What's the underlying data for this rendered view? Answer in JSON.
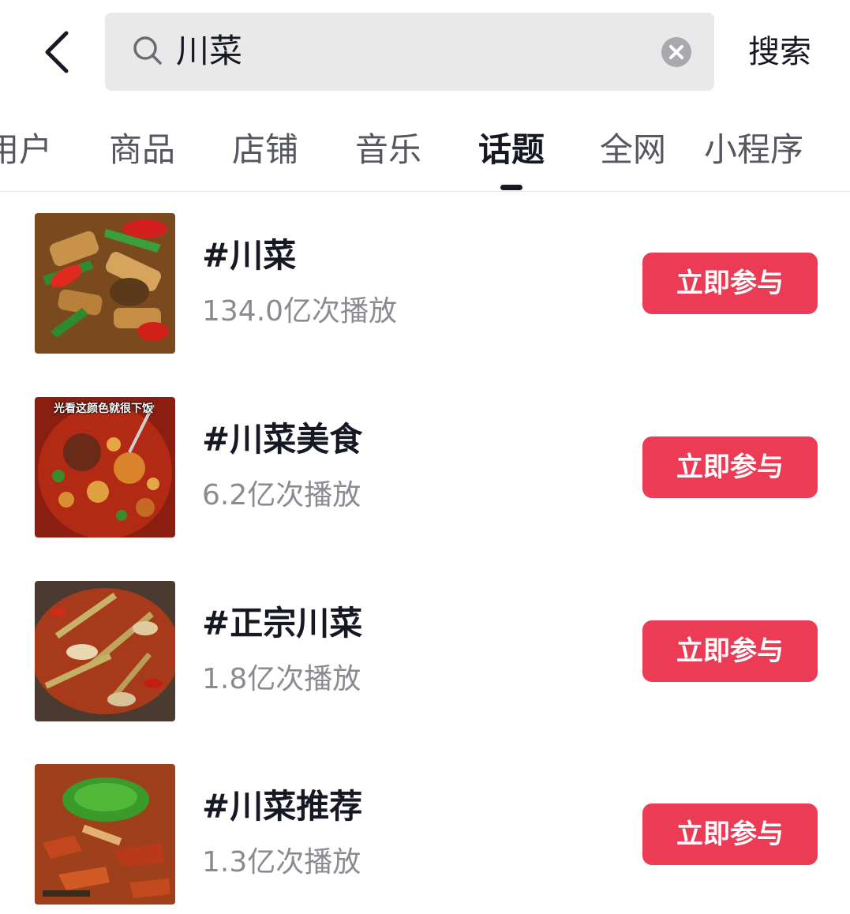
{
  "header": {
    "search_query": "川菜",
    "search_button": "搜索"
  },
  "tabs": [
    {
      "label": "用户",
      "active": false
    },
    {
      "label": "商品",
      "active": false
    },
    {
      "label": "店铺",
      "active": false
    },
    {
      "label": "音乐",
      "active": false
    },
    {
      "label": "话题",
      "active": true
    },
    {
      "label": "全网",
      "active": false
    },
    {
      "label": "小程序",
      "active": false
    }
  ],
  "topics": [
    {
      "title": "#川菜",
      "plays": "134.0亿次播放",
      "join_label": "立即参与",
      "thumb_overlay": ""
    },
    {
      "title": "#川菜美食",
      "plays": "6.2亿次播放",
      "join_label": "立即参与",
      "thumb_overlay": "光看这颜色就很下饭"
    },
    {
      "title": "#正宗川菜",
      "plays": "1.8亿次播放",
      "join_label": "立即参与",
      "thumb_overlay": ""
    },
    {
      "title": "#川菜推荐",
      "plays": "1.3亿次播放",
      "join_label": "立即参与",
      "thumb_overlay": ""
    }
  ],
  "colors": {
    "accent": "#ec3b55",
    "search_bg": "#e9e9ea",
    "text_primary": "#161823",
    "text_secondary": "#8a8b91"
  },
  "icons": [
    "back-icon",
    "search-icon",
    "clear-icon"
  ]
}
